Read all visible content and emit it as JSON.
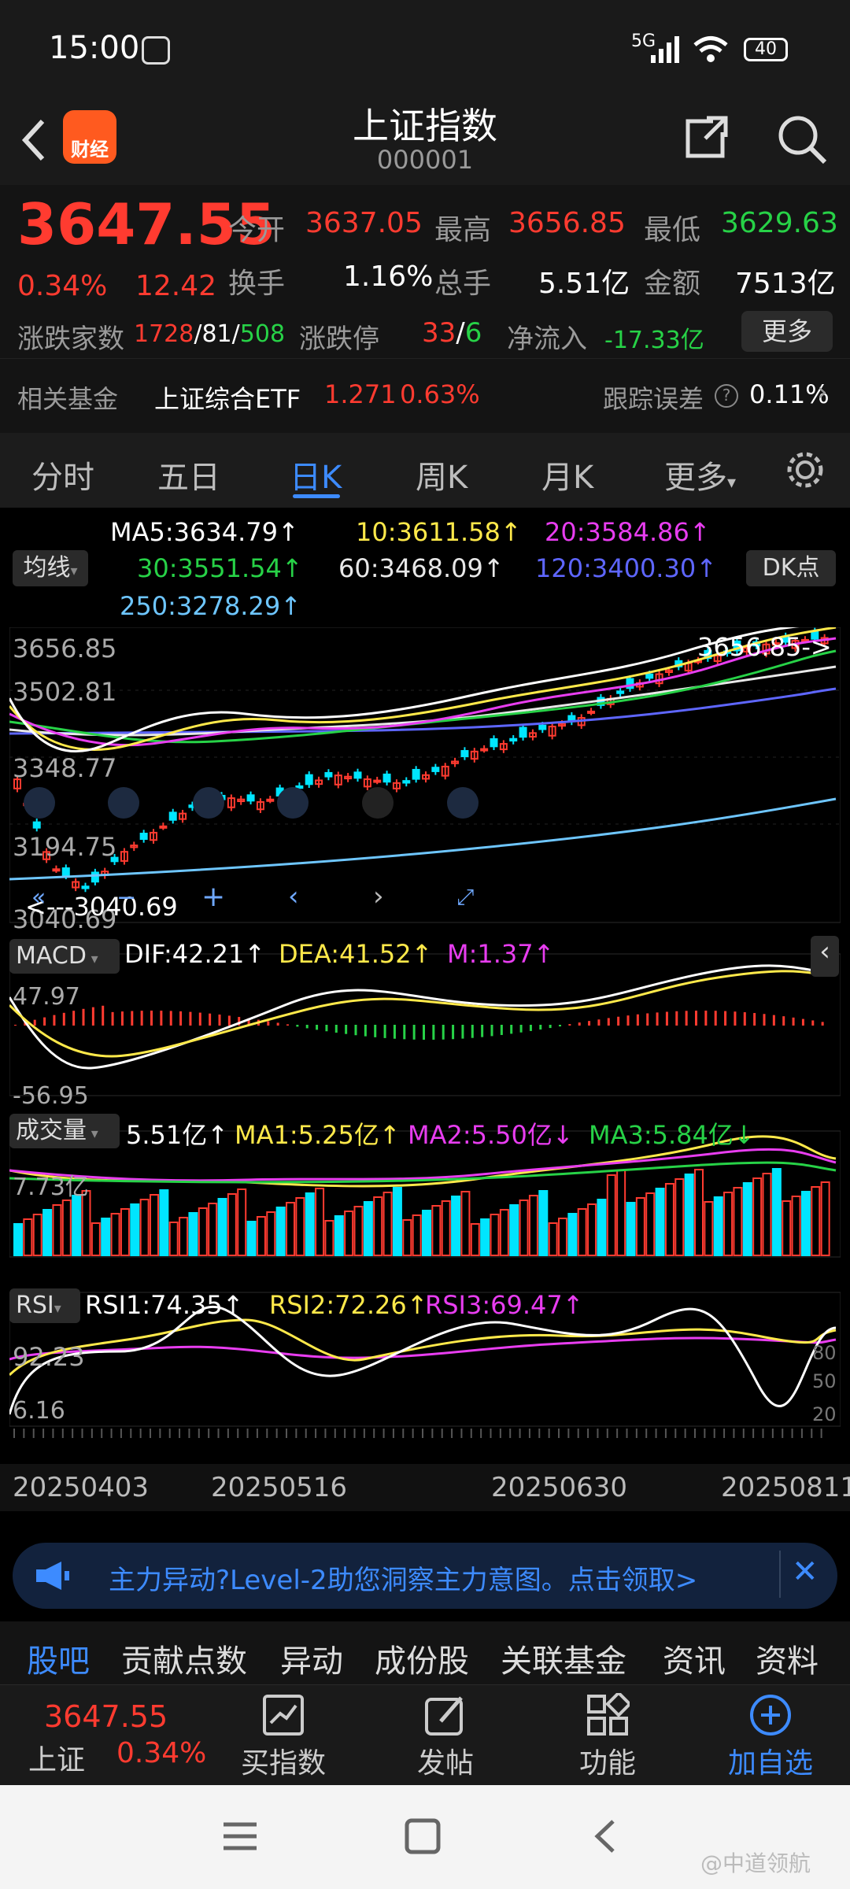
{
  "status": {
    "time": "15:00",
    "network": "5G",
    "battery": "40"
  },
  "header": {
    "title": "上证指数",
    "code": "000001",
    "logo_text": "财经"
  },
  "quote": {
    "price": "3647.55",
    "change_pct": "0.34%",
    "change": "12.42",
    "open_label": "今开",
    "open": "3637.05",
    "high_label": "最高",
    "high": "3656.85",
    "low_label": "最低",
    "low": "3629.63",
    "turnover_label": "换手",
    "turnover": "1.16%",
    "volume_label": "总手",
    "volume": "5.51亿",
    "amount_label": "金额",
    "amount": "7513亿",
    "breadth_label": "涨跌家数",
    "up": "1728",
    "flat": "81",
    "down": "508",
    "limit_label": "涨跌停",
    "limit_up": "33",
    "limit_down": "6",
    "netflow_label": "净流入",
    "netflow": "-17.33亿",
    "more_label": "更多"
  },
  "fund": {
    "label": "相关基金",
    "name": "上证综合ETF",
    "price": "1.271",
    "pct": "0.63%",
    "tracking_label": "跟踪误差",
    "tracking": "0.11%"
  },
  "tabs": [
    "分时",
    "五日",
    "日K",
    "周K",
    "月K",
    "更多"
  ],
  "active_tab": "日K",
  "ma": {
    "ma5": "MA5:3634.79↑",
    "ma10": "10:3611.58↑",
    "ma20": "20:3584.86↑",
    "ma30": "30:3551.54↑",
    "ma60": "60:3468.09↑",
    "ma120": "120:3400.30↑",
    "ma250": "250:3278.29↑",
    "selector": "均线",
    "dk": "DK点"
  },
  "kline": {
    "y_labels": [
      "3656.85",
      "3502.81",
      "3348.77",
      "3194.75",
      "3040.69"
    ],
    "high_tag": "3656.85->",
    "low_tag": "<---3040.69"
  },
  "macd": {
    "label": "MACD",
    "dif": "DIF:42.21↑",
    "dea": "DEA:41.52↑",
    "m": "M:1.37↑",
    "y_top": "47.97",
    "y_bottom": "-56.95"
  },
  "vol": {
    "label": "成交量",
    "v": "5.51亿↑",
    "ma1": "MA1:5.25亿↑",
    "ma2": "MA2:5.50亿↓",
    "ma3": "MA3:5.84亿↓",
    "y_top": "7.73亿"
  },
  "rsi": {
    "label": "RSI",
    "rsi1": "RSI1:74.35↑",
    "rsi2": "RSI2:72.26↑",
    "rsi3": "RSI3:69.47↑",
    "y_top": "92.23",
    "y_bottom": "6.16",
    "levels": [
      "80",
      "50",
      "20"
    ]
  },
  "dates": [
    "20250403",
    "20250516",
    "20250630",
    "20250811"
  ],
  "banner": {
    "text": "主力异动?Level-2助您洞察主力意图。点击领取>"
  },
  "bottom_tabs": [
    "股吧",
    "贡献点数",
    "异动",
    "成份股",
    "关联基金",
    "资讯",
    "资料"
  ],
  "footer": {
    "name": "上证",
    "price": "3647.55",
    "pct": "0.34%",
    "buy": "买指数",
    "post": "发帖",
    "func": "功能",
    "add": "加自选"
  },
  "watermark": "@中道领航",
  "chart_data": {
    "type": "candlestick",
    "x": [
      "20250403",
      "20250516",
      "20250630",
      "20250811"
    ],
    "ylim": [
      3040.69,
      3656.85
    ],
    "close_trend": [
      3340,
      3150,
      3100,
      3180,
      3230,
      3280,
      3300,
      3290,
      3320,
      3350,
      3340,
      3330,
      3360,
      3400,
      3420,
      3450,
      3470,
      3520,
      3560,
      3590,
      3610,
      3630,
      3640,
      3647.55
    ],
    "volume_ylim_top": "7.73亿",
    "rsi_range": [
      6.16,
      92.23
    ]
  }
}
